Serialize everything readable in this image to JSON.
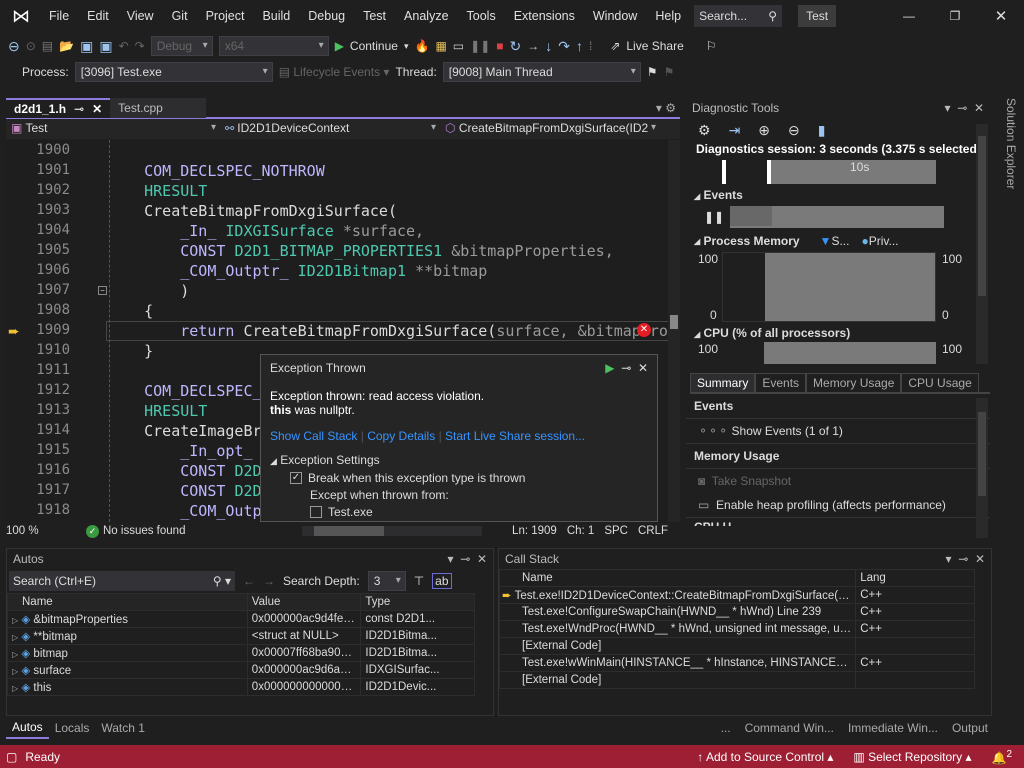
{
  "menu": [
    "File",
    "Edit",
    "View",
    "Git",
    "Project",
    "Build",
    "Debug",
    "Test",
    "Analyze",
    "Tools",
    "Extensions",
    "Window",
    "Help"
  ],
  "search_placeholder": "Search...",
  "solution_name": "Test",
  "toolbar": {
    "config": "Debug",
    "platform": "x64",
    "continue": "Continue",
    "live_share": "Live Share"
  },
  "debugbar": {
    "process_label": "Process:",
    "process": "[3096] Test.exe",
    "lifecycle": "Lifecycle Events",
    "thread_label": "Thread:",
    "thread": "[9008] Main Thread"
  },
  "editor": {
    "tabs": [
      "d2d1_1.h",
      "Test.cpp"
    ],
    "nav": [
      "Test",
      "ID2D1DeviceContext",
      "CreateBitmapFromDxgiSurface(ID2"
    ],
    "lines": [
      {
        "n": "1900",
        "tokens": []
      },
      {
        "n": "1901",
        "tokens": [
          [
            "    ",
            "p"
          ],
          [
            "COM_DECLSPEC_NOTHROW",
            "k"
          ]
        ]
      },
      {
        "n": "1902",
        "tokens": [
          [
            "    ",
            "p"
          ],
          [
            "HRESULT",
            "t"
          ]
        ]
      },
      {
        "n": "1903",
        "tokens": [
          [
            "    ",
            "p"
          ],
          [
            "CreateBitmapFromDxgiSurface(",
            "f"
          ]
        ]
      },
      {
        "n": "1904",
        "tokens": [
          [
            "        ",
            "p"
          ],
          [
            "_In_ ",
            "k"
          ],
          [
            "IDXGISurface ",
            "t"
          ],
          [
            "*surface,",
            "p"
          ]
        ]
      },
      {
        "n": "1905",
        "tokens": [
          [
            "        ",
            "p"
          ],
          [
            "CONST ",
            "k"
          ],
          [
            "D2D1_BITMAP_PROPERTIES1 ",
            "t"
          ],
          [
            "&bitmapProperties,",
            "p"
          ]
        ]
      },
      {
        "n": "1906",
        "tokens": [
          [
            "        ",
            "p"
          ],
          [
            "_COM_Outptr_ ",
            "k"
          ],
          [
            "ID2D1Bitmap1 ",
            "t"
          ],
          [
            "**bitmap",
            "p"
          ]
        ]
      },
      {
        "n": "1907",
        "tokens": [
          [
            "        ",
            "p"
          ],
          [
            ")",
            "f"
          ]
        ]
      },
      {
        "n": "1908",
        "tokens": [
          [
            "    ",
            "p"
          ],
          [
            "{",
            "f"
          ]
        ]
      },
      {
        "n": "1909",
        "tokens": [
          [
            "        ",
            "p"
          ],
          [
            "return ",
            "k"
          ],
          [
            "CreateBitmapFromDxgiSurface(",
            "f"
          ],
          [
            "surface, &bitmapProperties",
            "p"
          ]
        ]
      },
      {
        "n": "1910",
        "tokens": [
          [
            "    ",
            "p"
          ],
          [
            "}",
            "f"
          ]
        ]
      },
      {
        "n": "1911",
        "tokens": []
      },
      {
        "n": "1912",
        "tokens": [
          [
            "    ",
            "p"
          ],
          [
            "COM_DECLSPEC_NOTHROW",
            "k"
          ]
        ]
      },
      {
        "n": "1913",
        "tokens": [
          [
            "    ",
            "p"
          ],
          [
            "HRESULT",
            "t"
          ]
        ]
      },
      {
        "n": "1914",
        "tokens": [
          [
            "    ",
            "p"
          ],
          [
            "CreateImageBrush(",
            "f"
          ]
        ]
      },
      {
        "n": "1915",
        "tokens": [
          [
            "        ",
            "p"
          ],
          [
            "_In_opt_ ",
            "k"
          ]
        ]
      },
      {
        "n": "1916",
        "tokens": [
          [
            "        ",
            "p"
          ],
          [
            "CONST ",
            "k"
          ],
          [
            "D2D1",
            "t"
          ]
        ]
      },
      {
        "n": "1917",
        "tokens": [
          [
            "        ",
            "p"
          ],
          [
            "CONST ",
            "k"
          ],
          [
            "D2D1",
            "t"
          ]
        ]
      },
      {
        "n": "1918",
        "tokens": [
          [
            "        ",
            "p"
          ],
          [
            "_COM_Outptr_",
            "k"
          ]
        ]
      }
    ],
    "status": {
      "zoom": "100 %",
      "issues": "No issues found",
      "ln": "Ln: 1909",
      "ch": "Ch: 1",
      "spc": "SPC",
      "crlf": "CRLF"
    }
  },
  "exception": {
    "title": "Exception Thrown",
    "msg1": "Exception thrown: read access violation.",
    "msg2_bold": "this",
    "msg2": " was nullptr.",
    "links": [
      "Show Call Stack",
      "Copy Details",
      "Start Live Share session..."
    ],
    "settings": "Exception Settings",
    "break_label": "Break when this exception type is thrown",
    "break_checked": true,
    "except_label": "Except when thrown from:",
    "module": "Test.exe",
    "module_checked": false
  },
  "diag": {
    "title": "Diagnostic Tools",
    "session": "Diagnostics session: 3 seconds (3.375 s selected)",
    "tick": "10s",
    "events": "Events",
    "memory": "Process Memory",
    "legend_s": "S...",
    "legend_p": "Priv...",
    "y_max": "100",
    "y_min": "0",
    "cpu": "CPU (% of all processors)",
    "tabs": [
      "Summary",
      "Events",
      "Memory Usage",
      "CPU Usage"
    ],
    "sec_events": "Events",
    "show_events": "Show Events (1 of 1)",
    "sec_memory": "Memory Usage",
    "snapshot": "Take Snapshot",
    "heap": "Enable heap profiling (affects performance)",
    "sec_cpu": "CPU U"
  },
  "solution_explorer": "Solution Explorer",
  "autos": {
    "title": "Autos",
    "search": "Search (Ctrl+E)",
    "depth_label": "Search Depth:",
    "depth": "3",
    "cols": [
      "Name",
      "Value",
      "Type"
    ],
    "rows": [
      [
        "&bitmapProperties",
        "0x000000ac9d4fec18 {pixelFormat={form...",
        "const D2D1..."
      ],
      [
        "**bitmap",
        "<struct at NULL>",
        "ID2D1Bitma..."
      ],
      [
        "bitmap",
        "0x00007ff68ba901c0 {Test.exe!ID2D1Bitm...",
        "ID2D1Bitma..."
      ],
      [
        "surface",
        "0x000000ac9d6ab8d0 <No type informati...",
        "IDXGISurfac..."
      ],
      [
        "this",
        "0x0000000000000000 <NULL>",
        "ID2D1Devic..."
      ]
    ]
  },
  "callstack": {
    "title": "Call Stack",
    "cols": [
      "Name",
      "Lang"
    ],
    "rows": [
      [
        "Test.exe!ID2D1DeviceContext::CreateBitmapFromDxgiSurface(IDXGISurface * s...",
        "C++"
      ],
      [
        "Test.exe!ConfigureSwapChain(HWND__ * hWnd) Line 239",
        "C++"
      ],
      [
        "Test.exe!WndProc(HWND__ * hWnd, unsigned int message, unsigned __int64 ...",
        "C++"
      ],
      [
        "[External Code]",
        ""
      ],
      [
        "Test.exe!wWinMain(HINSTANCE__ * hInstance, HINSTANCE__ * hPrevInstance,...",
        "C++"
      ],
      [
        "[External Code]",
        ""
      ]
    ]
  },
  "bottom_tabs_left": [
    "Autos",
    "Locals",
    "Watch 1"
  ],
  "bottom_tabs_right": [
    "...",
    "Command Win...",
    "Immediate Win...",
    "Output"
  ],
  "statusbar": {
    "ready": "Ready",
    "source": "Add to Source Control",
    "repo": "Select Repository",
    "notifications": "2",
    "color": "#9e1f34"
  }
}
